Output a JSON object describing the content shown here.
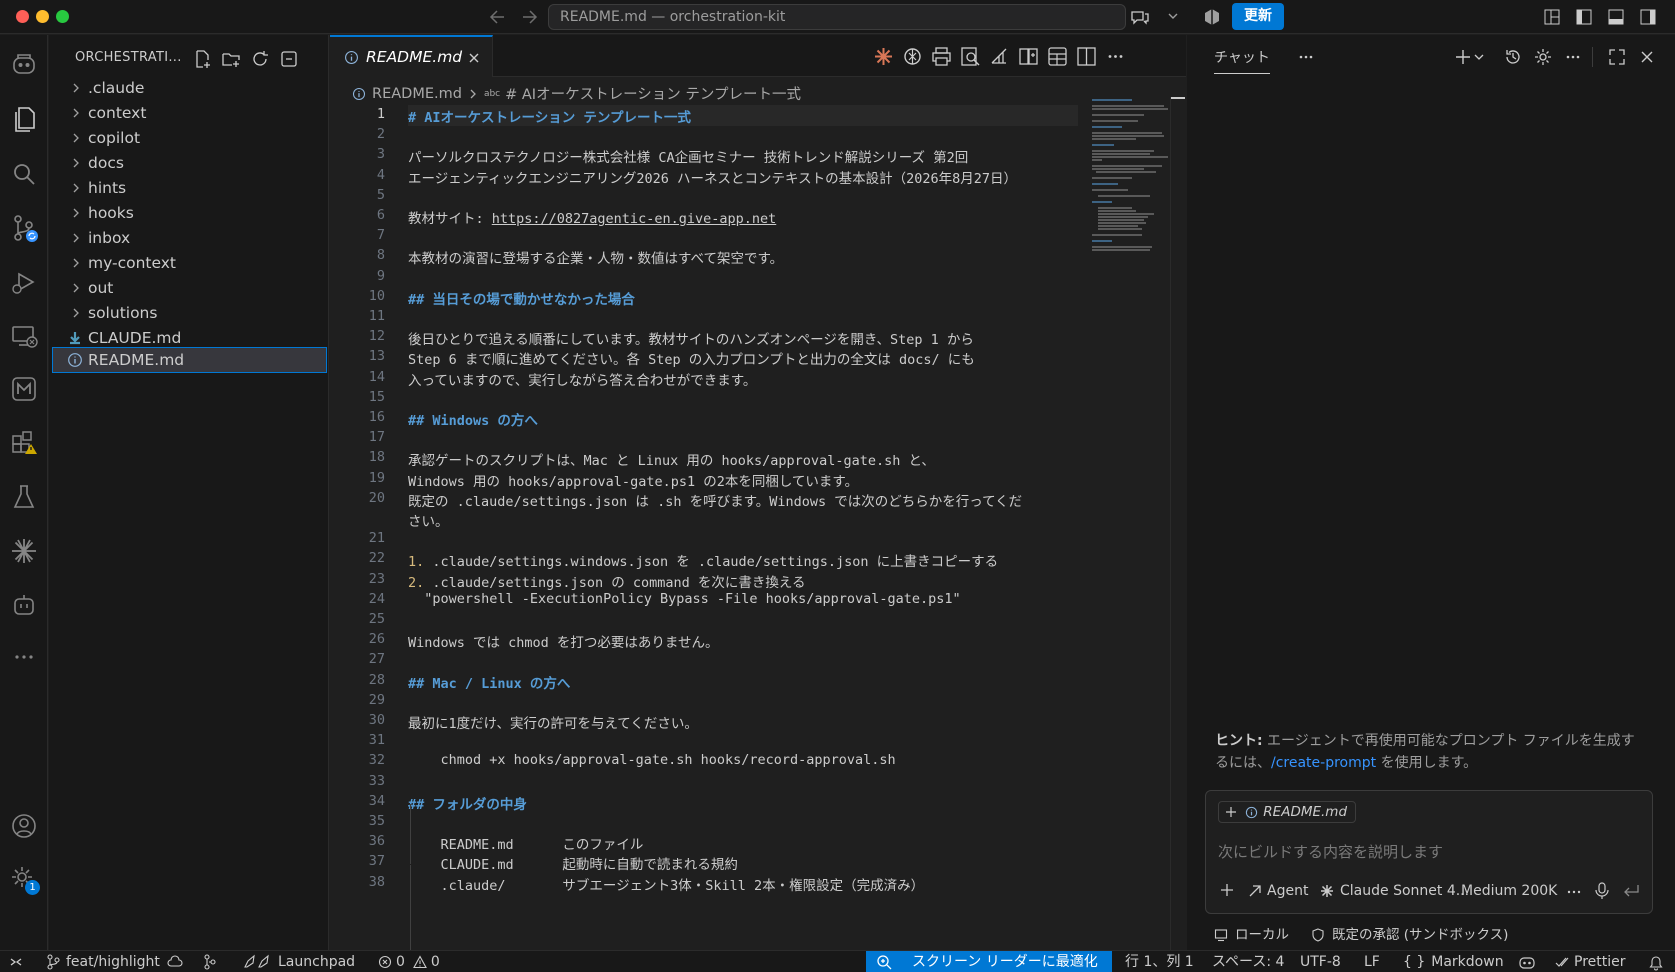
{
  "window": {
    "title": "README.md — orchestration-kit",
    "update_button": "更新"
  },
  "explorer": {
    "title": "ORCHESTRATI...",
    "items": [
      {
        "label": ".claude",
        "kind": "folder"
      },
      {
        "label": "context",
        "kind": "folder"
      },
      {
        "label": "copilot",
        "kind": "folder"
      },
      {
        "label": "docs",
        "kind": "folder"
      },
      {
        "label": "hints",
        "kind": "folder"
      },
      {
        "label": "hooks",
        "kind": "folder"
      },
      {
        "label": "inbox",
        "kind": "folder"
      },
      {
        "label": "my-context",
        "kind": "folder"
      },
      {
        "label": "out",
        "kind": "folder"
      },
      {
        "label": "solutions",
        "kind": "folder"
      },
      {
        "label": "CLAUDE.md",
        "kind": "file"
      },
      {
        "label": "README.md",
        "kind": "file",
        "selected": true
      }
    ]
  },
  "editor": {
    "tab_label": "README.md",
    "breadcrumb": {
      "file": "README.md",
      "symbol": "# AIオーケストレーション テンプレート一式"
    },
    "lines": [
      {
        "n": "1",
        "text": "# AIオーケストレーション テンプレート一式",
        "style": "h"
      },
      {
        "n": "2",
        "text": ""
      },
      {
        "n": "3",
        "text": "パーソルクロステクノロジー株式会社様 CA企画セミナー 技術トレンド解説シリーズ 第2回"
      },
      {
        "n": "4",
        "text": "エージェンティックエンジニアリング2026 ハーネスとコンテキストの基本設計（2026年8月27日）"
      },
      {
        "n": "5",
        "text": ""
      },
      {
        "n": "6",
        "text": "教材サイト: ",
        "link": "https://0827agentic-en.give-app.net"
      },
      {
        "n": "7",
        "text": ""
      },
      {
        "n": "8",
        "text": "本教材の演習に登場する企業・人物・数値はすべて架空です。"
      },
      {
        "n": "9",
        "text": ""
      },
      {
        "n": "10",
        "text": "## 当日その場で動かせなかった場合",
        "style": "h"
      },
      {
        "n": "11",
        "text": ""
      },
      {
        "n": "12",
        "text": "後日ひとりで追える順番にしています。教材サイトのハンズオンページを開き、Step 1 から"
      },
      {
        "n": "13",
        "text": "Step 6 まで順に進めてください。各 Step の入力プロンプトと出力の全文は docs/ にも"
      },
      {
        "n": "14",
        "text": "入っていますので、実行しながら答え合わせができます。"
      },
      {
        "n": "15",
        "text": ""
      },
      {
        "n": "16",
        "text": "## Windows の方へ",
        "style": "h"
      },
      {
        "n": "17",
        "text": ""
      },
      {
        "n": "18",
        "text": "承認ゲートのスクリプトは、Mac と Linux 用の hooks/approval-gate.sh と、"
      },
      {
        "n": "19",
        "text": "Windows 用の hooks/approval-gate.ps1 の2本を同梱しています。"
      },
      {
        "n": "20",
        "text": "既定の .claude/settings.json は .sh を呼びます。Windows では次のどちらかを行ってくだ"
      },
      {
        "n": "",
        "text": "さい。"
      },
      {
        "n": "21",
        "text": ""
      },
      {
        "n": "22",
        "text": ".claude/settings.windows.json を .claude/settings.json に上書きコピーする",
        "num": "1. "
      },
      {
        "n": "23",
        "text": ".claude/settings.json の command を次に書き換える",
        "num": "2. "
      },
      {
        "n": "24",
        "text": "  \"powershell -ExecutionPolicy Bypass -File hooks/approval-gate.ps1\""
      },
      {
        "n": "25",
        "text": ""
      },
      {
        "n": "26",
        "text": "Windows では chmod を打つ必要はありません。"
      },
      {
        "n": "27",
        "text": ""
      },
      {
        "n": "28",
        "text": "## Mac / Linux の方へ",
        "style": "h"
      },
      {
        "n": "29",
        "text": ""
      },
      {
        "n": "30",
        "text": "最初に1度だけ、実行の許可を与えてください。"
      },
      {
        "n": "31",
        "text": ""
      },
      {
        "n": "32",
        "text": "    chmod +x hooks/approval-gate.sh hooks/record-approval.sh"
      },
      {
        "n": "33",
        "text": ""
      },
      {
        "n": "34",
        "text": "## フォルダの中身",
        "style": "h"
      },
      {
        "n": "35",
        "text": ""
      },
      {
        "n": "36",
        "text": "    README.md      このファイル"
      },
      {
        "n": "37",
        "text": "    CLAUDE.md      起動時に自動で読まれる規約"
      },
      {
        "n": "38",
        "text": "    .claude/       サブエージェント3体・Skill 2本・権限設定（完成済み）"
      }
    ]
  },
  "chat": {
    "tab_label": "チャット",
    "hint": {
      "prefix": "ヒント:",
      "text_before": " エージェントで再使用可能なプロンプト ファイルを生成するには、",
      "link": "/create-prompt",
      "text_after": " を使用します。"
    },
    "context_chip": "README.md",
    "input_placeholder": "次にビルドする内容を説明します",
    "mode": "Agent",
    "model": "Claude Sonnet 4...",
    "context_size": "Medium 200K",
    "footer_location": "ローカル",
    "footer_approval": "既定の承認 (サンドボックス)"
  },
  "statusbar": {
    "branch": "feat/highlight",
    "launchpad": "Launchpad",
    "errors": "0",
    "warnings": "0",
    "screen_reader": "スクリーン リーダーに最適化",
    "cursor": "行 1、列 1",
    "spaces": "スペース: 4",
    "encoding": "UTF-8",
    "eol": "LF",
    "language": "Markdown",
    "formatter": "Prettier"
  },
  "activity_badges": {
    "settings": "1"
  },
  "colors": {
    "accent": "#0078d4",
    "heading": "#569cd6",
    "list_number": "#d7ba7d"
  }
}
